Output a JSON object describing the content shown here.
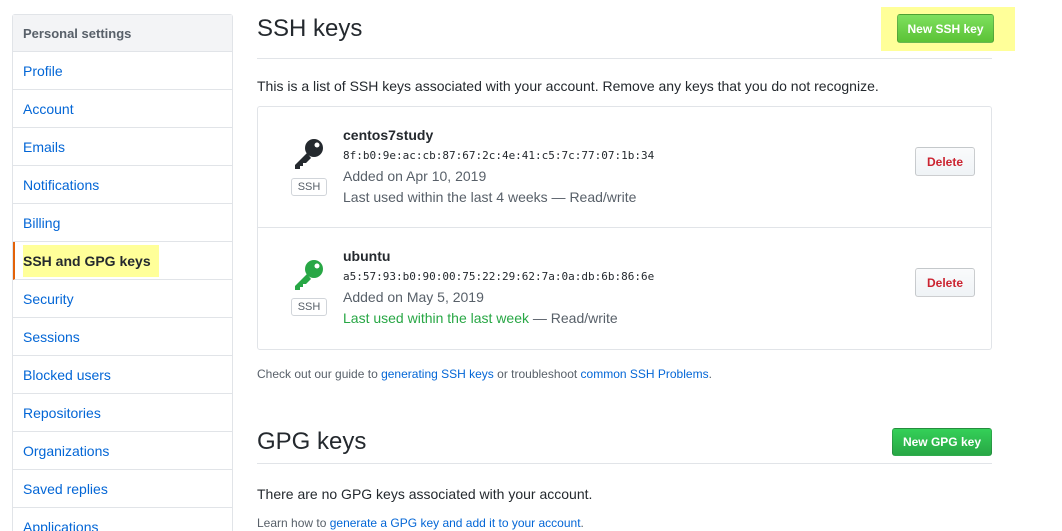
{
  "sidebar": {
    "header": "Personal settings",
    "items": [
      {
        "label": "Profile"
      },
      {
        "label": "Account"
      },
      {
        "label": "Emails"
      },
      {
        "label": "Notifications"
      },
      {
        "label": "Billing"
      },
      {
        "label": "SSH and GPG keys",
        "selected": true
      },
      {
        "label": "Security"
      },
      {
        "label": "Sessions"
      },
      {
        "label": "Blocked users"
      },
      {
        "label": "Repositories"
      },
      {
        "label": "Organizations"
      },
      {
        "label": "Saved replies"
      },
      {
        "label": "Applications"
      }
    ]
  },
  "ssh": {
    "title": "SSH keys",
    "new_button": "New SSH key",
    "description": "This is a list of SSH keys associated with your account. Remove any keys that you do not recognize.",
    "keys": [
      {
        "title": "centos7study",
        "fingerprint": "8f:b0:9e:ac:cb:87:67:2c:4e:41:c5:7c:77:07:1b:34",
        "added": "Added on Apr 10, 2019",
        "last_used": "Last used within the last 4 weeks",
        "access": " — Read/write",
        "type_label": "SSH",
        "delete_label": "Delete",
        "icon_color": "#24292e"
      },
      {
        "title": "ubuntu",
        "fingerprint": "a5:57:93:b0:90:00:75:22:29:62:7a:0a:db:6b:86:6e",
        "added": "Added on May 5, 2019",
        "last_used": "Last used within the last week",
        "access": " — Read/write",
        "type_label": "SSH",
        "delete_label": "Delete",
        "icon_color": "#28a745"
      }
    ],
    "guide_prefix": "Check out our guide to ",
    "guide_link1": "generating SSH keys",
    "guide_middle": " or troubleshoot ",
    "guide_link2": "common SSH Problems",
    "guide_suffix": "."
  },
  "gpg": {
    "title": "GPG keys",
    "new_button": "New GPG key",
    "empty_text": "There are no GPG keys associated with your account.",
    "learn_prefix": "Learn how to ",
    "learn_link": "generate a GPG key and add it to your account",
    "learn_suffix": "."
  }
}
